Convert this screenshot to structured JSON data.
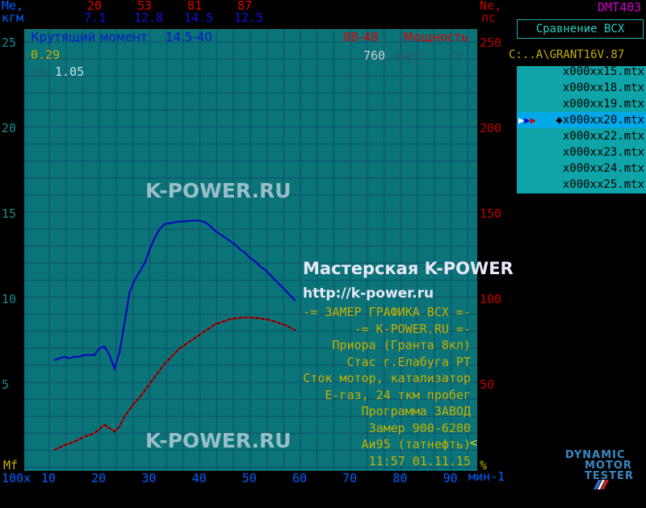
{
  "header": {
    "left_top": "Me,",
    "left_bottom": "кгм",
    "right_top": "Ne,",
    "right_bottom": "лс",
    "app_id": "DMT403",
    "rpm_marks": [
      {
        "rpm": "20",
        "torque": "7.1"
      },
      {
        "rpm": "53",
        "torque": "12.8"
      },
      {
        "rpm": "81",
        "torque": "14.5"
      },
      {
        "rpm": "87",
        "torque": "12.5"
      }
    ]
  },
  "plot": {
    "torque_title": "Крутящий момент",
    "torque_value": "14.5-40",
    "power_value": "88-48",
    "power_title": "Мощность",
    "coef_a": "0.29",
    "cm_label": "cm",
    "cm_value": "1.05",
    "pressure_value": "760",
    "pressure_unit": "ммрс",
    "temp_unit": "°C",
    "watermark_top": "K-POWER.RU",
    "watermark_bottom": "K-POWER.RU",
    "shop_title": "Мастерская K-POWER",
    "shop_url": "http://k-power.ru",
    "info_lines": [
      "-= ЗАМЕР ГРАФИКА ВСХ =-",
      "-= K-POWER.RU =-",
      "Приора (Гранта 8кл)",
      "Стас г.Елабуга РТ",
      "Сток мотор, катализатор",
      "Е-газ, 24 ткм пробег",
      "Программа ЗАВОД",
      "Замер 900-6200",
      "Аи95 (татнефть)",
      "11:57 01.11.15"
    ],
    "info_marker": "<"
  },
  "axes": {
    "mf_label": "Mf",
    "percent_label": "%",
    "x_unit_left": "100x",
    "x_unit_right": "мин-1",
    "x_ticks": [
      "10",
      "20",
      "30",
      "40",
      "50",
      "60",
      "70",
      "80",
      "90"
    ],
    "y_left_ticks": [
      "25",
      "20",
      "15",
      "10",
      "5"
    ],
    "y_right_ticks": [
      "250",
      "200",
      "150",
      "100",
      "50"
    ]
  },
  "sidebar": {
    "compare_label": "Сравнение  ВСХ",
    "path": "C:..A\\GRANT16V.87",
    "files": [
      {
        "name": "x000xx15.mtx",
        "selected": false
      },
      {
        "name": "x000xx18.mtx",
        "selected": false
      },
      {
        "name": "x000xx19.mtx",
        "selected": false
      },
      {
        "name": "x000xx20.mtx",
        "selected": true
      },
      {
        "name": "x000xx22.mtx",
        "selected": false
      },
      {
        "name": "x000xx23.mtx",
        "selected": false
      },
      {
        "name": "x000xx24.mtx",
        "selected": false
      },
      {
        "name": "x000xx25.mtx",
        "selected": false
      }
    ],
    "selected_marker": "◆"
  },
  "logo": {
    "line1": "DYNAMIC",
    "line2": "MOTOR",
    "line3": "TESTER"
  },
  "colors": {
    "torque": "#0000c0",
    "power": "#c00000",
    "plot_bg": "#0a7478",
    "grid": "#0f4f6a"
  },
  "chart_data": {
    "type": "line",
    "x_unit": "100x мин-1",
    "xlim": [
      10,
      95
    ],
    "y_left_lim": [
      0,
      25
    ],
    "y_right_lim": [
      0,
      250
    ],
    "series": [
      {
        "name": "Крутящий момент",
        "axis": "left",
        "x": [
          11,
          12,
          13,
          14,
          15,
          16,
          17,
          18,
          19,
          20,
          21,
          22,
          23,
          24,
          25,
          26,
          27,
          28,
          29,
          30,
          31,
          32,
          33,
          34,
          35,
          36,
          37,
          38,
          39,
          40,
          41,
          42,
          43,
          44,
          45,
          46,
          47,
          48,
          49,
          50,
          51,
          52,
          53,
          54,
          55,
          56,
          57,
          58,
          59
        ],
        "y": [
          6.3,
          6.4,
          6.5,
          6.4,
          6.5,
          6.5,
          6.6,
          6.6,
          6.6,
          7.0,
          7.1,
          6.6,
          5.8,
          6.8,
          8.5,
          10.3,
          11.0,
          11.5,
          12.0,
          12.8,
          13.5,
          14.0,
          14.3,
          14.35,
          14.4,
          14.45,
          14.45,
          14.5,
          14.5,
          14.5,
          14.4,
          14.2,
          13.9,
          13.7,
          13.5,
          13.3,
          13.1,
          12.8,
          12.6,
          12.3,
          12.1,
          11.8,
          11.6,
          11.3,
          11.0,
          10.7,
          10.4,
          10.1,
          9.8
        ]
      },
      {
        "name": "Мощность",
        "axis": "right",
        "x": [
          11,
          13,
          15,
          17,
          19,
          21,
          22,
          23,
          24,
          25,
          26,
          27,
          28,
          29,
          30,
          31,
          32,
          33,
          34,
          35,
          36,
          37,
          38,
          39,
          40,
          41,
          42,
          43,
          44,
          45,
          46,
          47,
          48,
          49,
          50,
          51,
          52,
          53,
          54,
          55,
          56,
          57,
          58,
          59
        ],
        "y": [
          10,
          13,
          15,
          18,
          20,
          25,
          23,
          21,
          24,
          30,
          34,
          38,
          41,
          45,
          49,
          53,
          57,
          61,
          64,
          67,
          70,
          72,
          74,
          76,
          78,
          80,
          82,
          84,
          85,
          86,
          87,
          87.5,
          87.8,
          88,
          88,
          87.8,
          87.5,
          87,
          86.5,
          85.5,
          84.5,
          83.5,
          82,
          80.5
        ]
      }
    ]
  }
}
